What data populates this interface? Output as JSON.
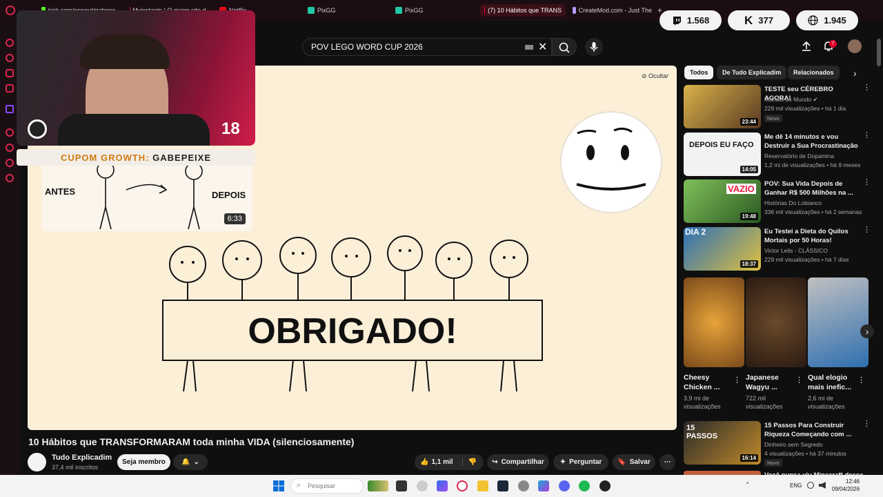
{
  "browser": {
    "tabs": [
      {
        "label": "kick.com/popout/gabepe...",
        "color": "#53fc18"
      },
      {
        "label": "Myinstants | O maior site d...",
        "color": "#e0244d"
      },
      {
        "label": "Netflix",
        "color": "#e50914"
      },
      {
        "label": "PixGG",
        "color": "#20c7a6"
      },
      {
        "label": "PixGG",
        "color": "#20c7a6"
      },
      {
        "label": "(7) 10 Hábitos que TRANS",
        "color": "#ff0033"
      },
      {
        "label": "CreateMod.com - Just The",
        "color": "#b79cff"
      }
    ],
    "new_tab": "+"
  },
  "counters": {
    "twitch": "1.568",
    "kick": "377",
    "total": "1.945"
  },
  "youtube": {
    "search_value": "POV LEGO WORD CUP 2026",
    "notifications": "7",
    "hide_label": "Ocultar"
  },
  "overlay": {
    "live_number": "18",
    "coupon_prefix": "CUPOM GROWTH:",
    "coupon_code": "GABEPEIXE",
    "mini_before": "ANTES",
    "mini_after": "DEPOIS",
    "mini_duration": "6:33"
  },
  "video": {
    "banner_text": "OBRIGADO!",
    "title": "10 Hábitos que TRANSFORMARAM toda minha VIDA (silenciosamente)",
    "channel": "Tudo Explicadim",
    "subscribers": "37,4 mil inscritos",
    "member_label": "Seja membro",
    "likes": "1,1 mil",
    "share_label": "Compartilhar",
    "ask_label": "Perguntar",
    "save_label": "Salvar"
  },
  "chips": [
    "Todos",
    "De Tudo Explicadim",
    "Relacionados"
  ],
  "recommendations": [
    {
      "title": "TESTE seu CÉREBRO AGORA!",
      "channel": "Manual do Mundo ✔",
      "views": "229 mil visualizações • há 1 dia",
      "badge": "Novo",
      "duration": "23:44",
      "thumb_text": "",
      "color": "#6b4a2a"
    },
    {
      "title": "Me dê 14 minutos e vou Destruir a Sua Procrastinação",
      "channel": "Reservatório de Dopamina",
      "views": "1,2 mi de visualizações • há 9 meses",
      "badge": "",
      "duration": "14:05",
      "thumb_text": "DEPOIS EU FAÇO",
      "color": "#f2f2f2"
    },
    {
      "title": "POV: Sua Vida Depois de Ganhar R$ 500 Milhões na ...",
      "channel": "Histórias Do Lobianco",
      "views": "336 mil visualizações • há 2 semanas",
      "badge": "",
      "duration": "19:48",
      "thumb_text": "VAZIO",
      "color": "#3f7f3a"
    },
    {
      "title": "Eu Testei a Dieta do Quilos Mortais por 50 Horas!",
      "channel": "Victor Lelis - CLÁSSICO",
      "views": "229 mil visualizações • há 7 dias",
      "badge": "",
      "duration": "18:37",
      "thumb_text": "DIA 2",
      "color": "#2a6fb8"
    }
  ],
  "shorts": [
    {
      "title": "Cheesy Chicken ...",
      "views": "3,9 mi de visualizações",
      "color": "#e8a33a"
    },
    {
      "title": "Japanese Wagyu ...",
      "views": "722 mil visualizações",
      "color": "#5a3a2a"
    },
    {
      "title": "Qual elogio mais inefic...",
      "views": "2,6 mi de visualizações",
      "color": "#2f6fb0"
    }
  ],
  "rec_bottom": {
    "title": "15 Passos Para Construir Riqueza Começando com ...",
    "channel": "Dinheiro sem Segredo",
    "views": "4 visualizações • há 37 minutos",
    "badge": "Novo",
    "duration": "16:14",
    "thumb_text": "15 PASSOS",
    "color": "#1a1a1a"
  },
  "rec_cut": {
    "title": "Você nunca viu Minecraft desse"
  },
  "taskbar": {
    "search_placeholder": "Pesquisar",
    "lang": "ENG",
    "time": "12:46",
    "date": "09/04/2026"
  }
}
